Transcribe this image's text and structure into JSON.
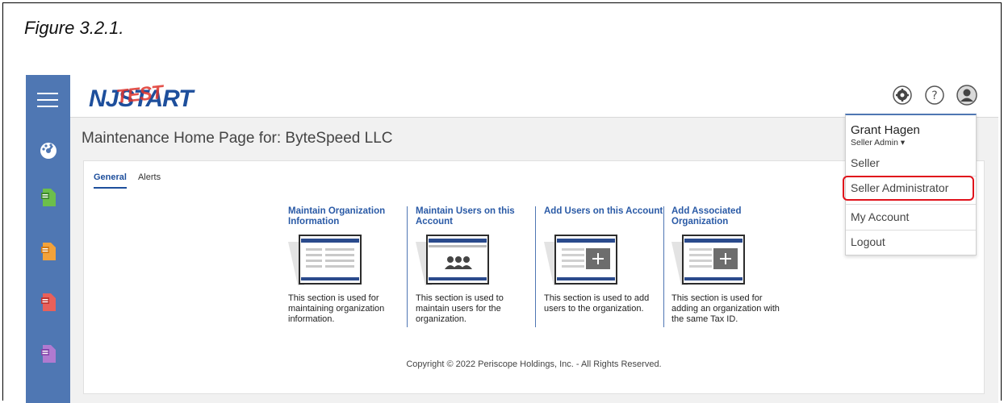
{
  "figure": {
    "caption": "Figure 3.2.1."
  },
  "app": {
    "logo_text": "NJSTART",
    "logo_overlay": "TEST"
  },
  "header": {
    "icons": [
      "gear-icon",
      "help-icon",
      "user-icon"
    ]
  },
  "sidebar": {
    "items": [
      "dashboard-icon",
      "document-green-icon",
      "document-orange-icon",
      "document-red-icon",
      "document-purple-icon"
    ]
  },
  "page": {
    "heading": "Maintenance Home Page for: ByteSpeed LLC"
  },
  "tabs": [
    {
      "label": "General"
    },
    {
      "label": "Alerts"
    }
  ],
  "tiles": [
    {
      "title": "Maintain Organization Information",
      "description": "This section is used for maintaining organization information."
    },
    {
      "title": "Maintain Users on this Account",
      "description": "This section is used to maintain users for the organization."
    },
    {
      "title": "Add Users on this Account",
      "description": "This section is used to add users to the organization."
    },
    {
      "title": "Add Associated Organization",
      "description": "This section is used for adding an organization with the same Tax ID."
    }
  ],
  "footer": {
    "copyright": "Copyright © 2022 Periscope Holdings, Inc. - All Rights Reserved."
  },
  "user_menu": {
    "name": "Grant Hagen",
    "role": "Seller Admin ▾",
    "items": [
      {
        "label": "Seller"
      },
      {
        "label": "Seller Administrator"
      },
      {
        "label": "My Account"
      },
      {
        "label": "Logout"
      }
    ],
    "highlight_color": "#e0121b"
  },
  "colors": {
    "brand_blue": "#1e4f9c",
    "sidebar": "#4f77b3",
    "accent_red": "#e0342c"
  }
}
